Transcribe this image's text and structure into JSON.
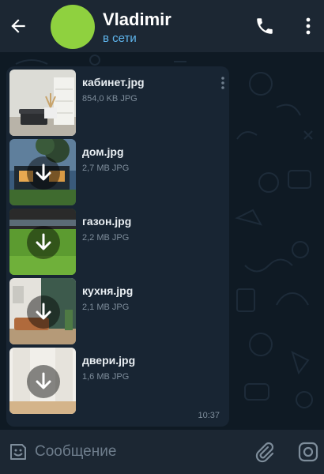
{
  "header": {
    "title": "Vladimir",
    "status": "в сети",
    "avatar_color": "#8fd13f",
    "status_color": "#5fb6ee",
    "icons": [
      "back-arrow-icon",
      "phone-icon",
      "more-vertical-icon"
    ]
  },
  "message": {
    "time": "10:37",
    "files": [
      {
        "name": "кабинет.jpg",
        "meta": "854,0 KB JPG",
        "downloaded": true
      },
      {
        "name": "дом.jpg",
        "meta": "2,7 MB JPG",
        "downloaded": false
      },
      {
        "name": "газон.jpg",
        "meta": "2,2 MB JPG",
        "downloaded": false
      },
      {
        "name": "кухня.jpg",
        "meta": "2,1 MB JPG",
        "downloaded": false
      },
      {
        "name": "двери.jpg",
        "meta": "1,6 MB JPG",
        "downloaded": false
      }
    ]
  },
  "input": {
    "placeholder": "Сообщение",
    "icons": [
      "sticker-icon",
      "attach-icon",
      "camera-icon"
    ]
  },
  "colors": {
    "background": "#0e1621",
    "header": "#1c2733",
    "bubble": "#182533",
    "accent": "#5fb6ee"
  }
}
